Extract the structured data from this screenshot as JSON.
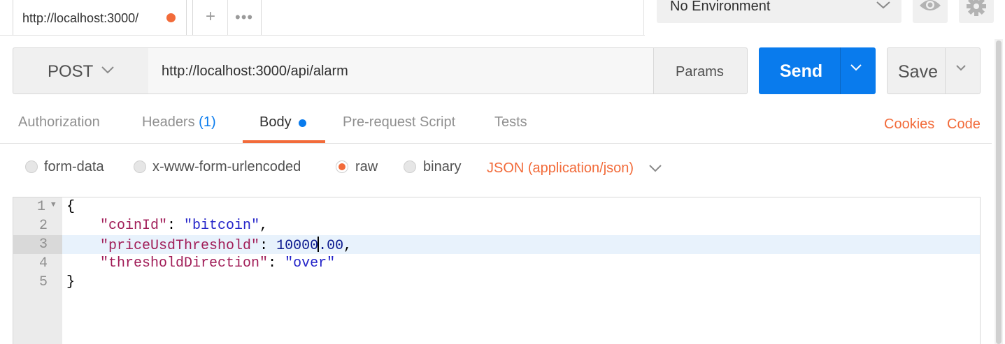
{
  "tabs": {
    "active_url": "http://localhost:3000/",
    "new_tab_label": "+",
    "more_label": "•••"
  },
  "environment": {
    "selected": "No Environment"
  },
  "request": {
    "method": "POST",
    "url": "http://localhost:3000/api/alarm",
    "params_label": "Params",
    "send_label": "Send",
    "save_label": "Save"
  },
  "subtabs": {
    "authorization": "Authorization",
    "headers": "Headers",
    "headers_count": "(1)",
    "body": "Body",
    "pre_request": "Pre-request Script",
    "tests": "Tests",
    "cookies": "Cookies",
    "code": "Code"
  },
  "body_types": {
    "form_data": "form-data",
    "urlencoded": "x-www-form-urlencoded",
    "raw": "raw",
    "binary": "binary",
    "selected": "raw",
    "content_type": "JSON (application/json)"
  },
  "editor": {
    "lines": [
      {
        "num": "1",
        "text": "{"
      },
      {
        "num": "2",
        "key": "\"coinId\"",
        "value": "\"bitcoin\"",
        "trail": ","
      },
      {
        "num": "3",
        "key": "\"priceUsdThreshold\"",
        "value_before_cursor": "10000",
        "value_after_cursor": ".00",
        "trail": ","
      },
      {
        "num": "4",
        "key": "\"thresholdDirection\"",
        "value": "\"over\"",
        "trail": ""
      },
      {
        "num": "5",
        "text": "}"
      }
    ],
    "active_line": "3"
  },
  "colors": {
    "accent_blue": "#097bed",
    "accent_orange": "#f26b3a",
    "json_key": "#a11d58",
    "json_string": "#2424c9"
  }
}
